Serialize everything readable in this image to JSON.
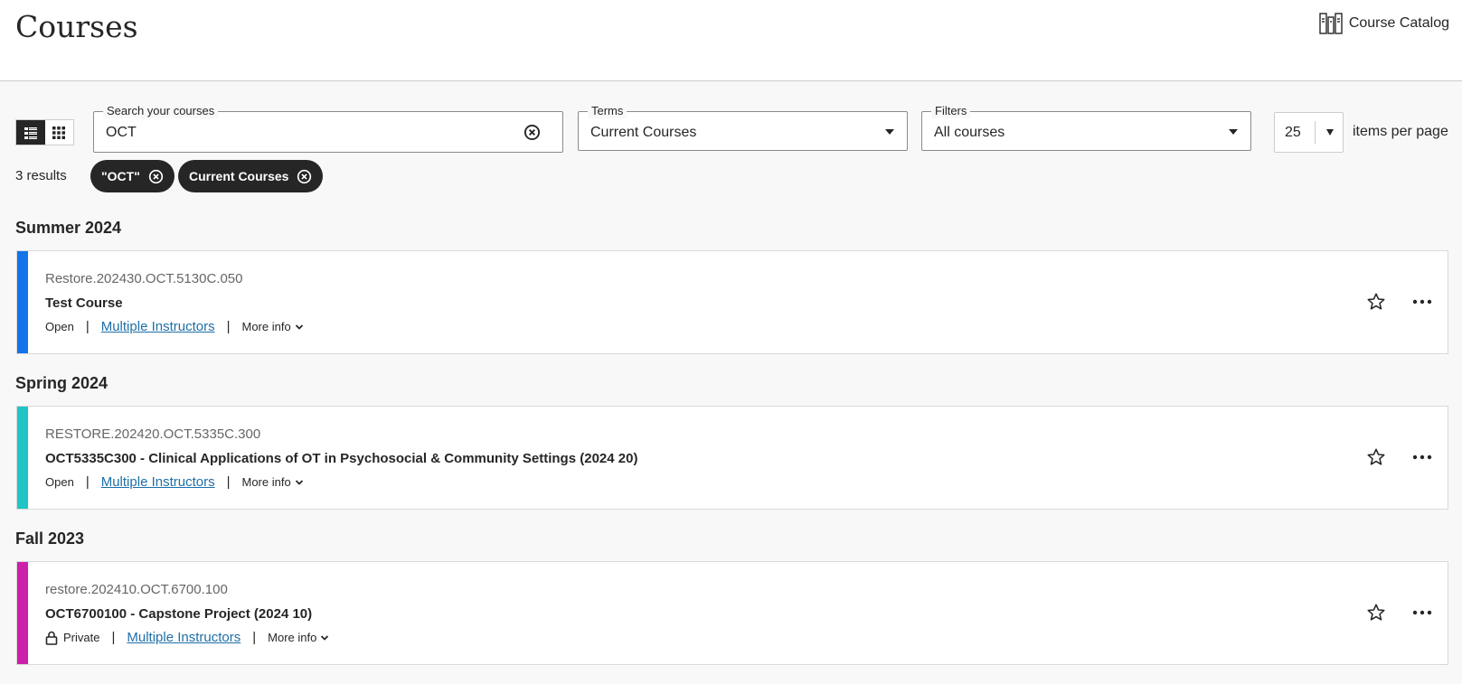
{
  "header": {
    "title": "Courses",
    "catalog_label": "Course Catalog"
  },
  "toolbar": {
    "view_list_icon": "list-view-icon",
    "view_grid_icon": "grid-view-icon",
    "search": {
      "label": "Search your courses",
      "value": "OCT"
    },
    "terms": {
      "label": "Terms",
      "value": "Current Courses"
    },
    "filters": {
      "label": "Filters",
      "value": "All courses"
    },
    "items_per_page": {
      "value": "25",
      "label": "items per page"
    }
  },
  "results": {
    "count_text": "3 results",
    "chips": [
      {
        "label": "\"OCT\""
      },
      {
        "label": "Current Courses"
      }
    ]
  },
  "sections": [
    {
      "term": "Summer 2024",
      "course": {
        "code": "Restore.202430.OCT.5130C.050",
        "name": "Test Course",
        "status": "Open",
        "instructors": "Multiple Instructors",
        "more_info": "More info",
        "color": "#1273eb"
      }
    },
    {
      "term": "Spring 2024",
      "course": {
        "code": "RESTORE.202420.OCT.5335C.300",
        "name": "OCT5335C300 - Clinical Applications of OT in Psychosocial & Community Settings (2024 20)",
        "status": "Open",
        "instructors": "Multiple Instructors",
        "more_info": "More info",
        "color": "#1fc4c4"
      }
    },
    {
      "term": "Fall 2023",
      "course": {
        "code": "restore.202410.OCT.6700.100",
        "name": "OCT6700100 - Capstone Project (2024 10)",
        "status": "Private",
        "instructors": "Multiple Instructors",
        "more_info": "More info",
        "color": "#cc1faa"
      }
    }
  ]
}
